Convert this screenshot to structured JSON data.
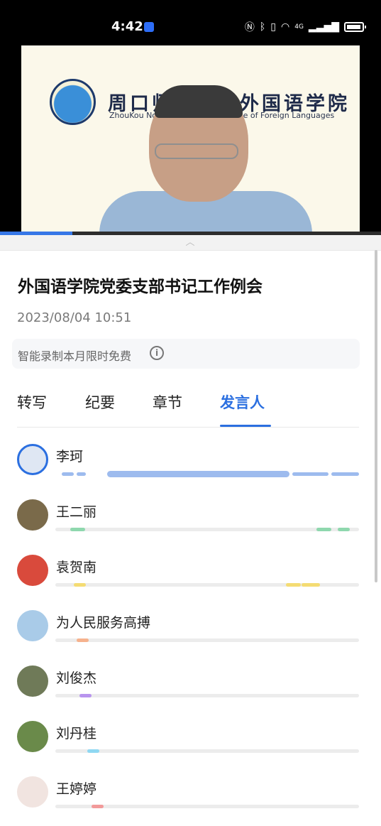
{
  "status_bar": {
    "time": "4:42",
    "network_label": "4G",
    "icons": [
      "nfc-icon",
      "bluetooth-icon",
      "vibrate-icon",
      "wifi-icon",
      "signal-icon",
      "battery-icon"
    ]
  },
  "video": {
    "logo_text_cn": "周口师范学院外国语学院",
    "logo_text_en": "ZhouKou Normal University College of Foreign Languages",
    "playback_progress": 0.19
  },
  "meeting": {
    "title": "外国语学院党委支部书记工作例会",
    "datetime": "2023/08/04 10:51",
    "notice": "智能录制本月限时免费"
  },
  "tabs": [
    {
      "label": "转写",
      "active": false
    },
    {
      "label": "纪要",
      "active": false
    },
    {
      "label": "章节",
      "active": false
    },
    {
      "label": "发言人",
      "active": true
    }
  ],
  "speakers": [
    {
      "name": "李珂",
      "color": "#9dbbee",
      "avatar_color": "#dfe7f3",
      "selected": true,
      "segments": [
        [
          0.02,
          0.06
        ],
        [
          0.07,
          0.1
        ],
        [
          0.17,
          0.77
        ],
        [
          0.78,
          0.9
        ],
        [
          0.91,
          1.0
        ]
      ]
    },
    {
      "name": "王二丽",
      "color": "#8fd8ae",
      "avatar_color": "#7a6a4a",
      "selected": false,
      "segments": [
        [
          0.05,
          0.1
        ],
        [
          0.86,
          0.91
        ],
        [
          0.93,
          0.97
        ]
      ]
    },
    {
      "name": "袁贺南",
      "color": "#f4dc73",
      "avatar_color": "#d94a3c",
      "selected": false,
      "segments": [
        [
          0.06,
          0.1
        ],
        [
          0.76,
          0.81
        ],
        [
          0.81,
          0.87
        ]
      ]
    },
    {
      "name": "为人民服务高搏",
      "color": "#f6b28d",
      "avatar_color": "#a9cbe8",
      "selected": false,
      "segments": [
        [
          0.07,
          0.11
        ]
      ]
    },
    {
      "name": "刘俊杰",
      "color": "#b894ee",
      "avatar_color": "#6f7a58",
      "selected": false,
      "segments": [
        [
          0.08,
          0.12
        ]
      ]
    },
    {
      "name": "刘丹桂",
      "color": "#8fd8f2",
      "avatar_color": "#6a8a4a",
      "selected": false,
      "segments": [
        [
          0.105,
          0.145
        ]
      ]
    },
    {
      "name": "王婷婷",
      "color": "#f29a9a",
      "avatar_color": "#f1e4e0",
      "selected": false,
      "segments": [
        [
          0.12,
          0.16
        ]
      ]
    }
  ]
}
